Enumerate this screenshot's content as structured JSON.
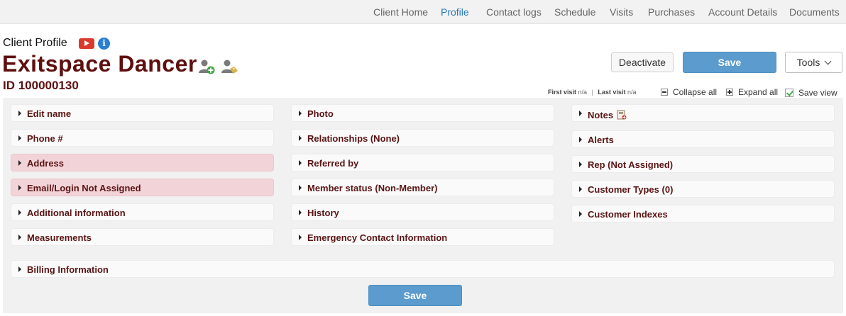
{
  "nav": {
    "tabs": [
      {
        "label": "Client Home",
        "active": false
      },
      {
        "label": "Profile",
        "active": true
      },
      {
        "label": "Contact logs",
        "active": false
      },
      {
        "label": "Schedule",
        "active": false
      },
      {
        "label": "Visits",
        "active": false
      },
      {
        "label": "Purchases",
        "active": false
      },
      {
        "label": "Account Details",
        "active": false
      },
      {
        "label": "Documents",
        "active": false
      }
    ]
  },
  "header": {
    "section_title": "Client Profile",
    "client_name": "Exitspace Dancer",
    "client_id": "ID 100000130",
    "icons": [
      "youtube-icon",
      "info-icon",
      "add-person-icon",
      "tag-person-icon"
    ]
  },
  "actions": {
    "deactivate_label": "Deactivate",
    "save_label": "Save",
    "tools_label": "Tools"
  },
  "visits": {
    "first_label": "First visit",
    "first_value": "n/a",
    "last_label": "Last visit",
    "last_value": "n/a"
  },
  "view_controls": {
    "collapse_label": "Collapse all",
    "expand_label": "Expand all",
    "save_view_label": "Save view",
    "save_view_checked": true
  },
  "columns": {
    "left": [
      {
        "label": "Edit name",
        "highlight": false
      },
      {
        "label": "Phone #",
        "highlight": false
      },
      {
        "label": "Address",
        "highlight": true
      },
      {
        "label": "Email/Login Not Assigned",
        "highlight": true
      },
      {
        "label": "Additional information",
        "highlight": false
      },
      {
        "label": "Measurements",
        "highlight": false
      }
    ],
    "middle": [
      {
        "label": "Photo"
      },
      {
        "label": "Relationships (None)"
      },
      {
        "label": "Referred by"
      },
      {
        "label": "Member status (Non-Member)"
      },
      {
        "label": "History"
      },
      {
        "label": "Emergency Contact Information"
      }
    ],
    "right": [
      {
        "label": "Notes"
      },
      {
        "label": "Alerts"
      },
      {
        "label": "Rep (Not Assigned)"
      },
      {
        "label": "Customer Types (0)"
      },
      {
        "label": "Customer Indexes"
      }
    ]
  },
  "billing": {
    "label": "Billing Information"
  },
  "footer": {
    "save_label": "Save"
  },
  "colors": {
    "accent_blue": "#5b9bcd",
    "active_tab": "#2a78b5",
    "name_maroon": "#5e0f0f",
    "highlight_pink": "#f2d3d8"
  }
}
